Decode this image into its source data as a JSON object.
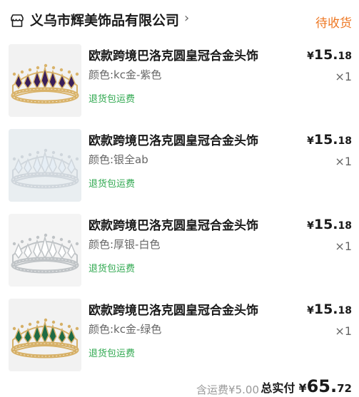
{
  "header": {
    "shop_icon": "store-icon",
    "shop_name": "义乌市辉美饰品有限公司",
    "chevron": "›",
    "status": "待收货"
  },
  "items": [
    {
      "title": "欧款跨境巴洛克圆皇冠合金头饰",
      "spec": "颜色:kc金-紫色",
      "tag": "退货包运费",
      "price_currency": "¥",
      "price_int": "15.",
      "price_dec": "18",
      "qty": "×1",
      "image": "crown-gold-purple",
      "colors": {
        "metal": "#d9b36a",
        "gem": "#3a1f5a",
        "bg": "#f2f2f2"
      }
    },
    {
      "title": "欧款跨境巴洛克圆皇冠合金头饰",
      "spec": "颜色:银全ab",
      "tag": "退货包运费",
      "price_currency": "¥",
      "price_int": "15.",
      "price_dec": "18",
      "qty": "×1",
      "image": "crown-silver-ab",
      "colors": {
        "metal": "#cfd6dc",
        "gem": "#e6eef5",
        "bg": "#e9eef1"
      }
    },
    {
      "title": "欧款跨境巴洛克圆皇冠合金头饰",
      "spec": "颜色:厚银-白色",
      "tag": "退货包运费",
      "price_currency": "¥",
      "price_int": "15.",
      "price_dec": "18",
      "qty": "×1",
      "image": "crown-silver-white",
      "colors": {
        "metal": "#bfc3c6",
        "gem": "#ffffff",
        "bg": "#f4f4f4"
      }
    },
    {
      "title": "欧款跨境巴洛克圆皇冠合金头饰",
      "spec": "颜色:kc金-绿色",
      "tag": "退货包运费",
      "price_currency": "¥",
      "price_int": "15.",
      "price_dec": "18",
      "qty": "×1",
      "image": "crown-gold-green",
      "colors": {
        "metal": "#d6b067",
        "gem": "#1e6b45",
        "bg": "#f2f2f2"
      }
    }
  ],
  "footer": {
    "shipping": "含运费¥5.00",
    "total_label": "总实付",
    "total_currency": "¥",
    "total_int": "65.",
    "total_dec": "72"
  },
  "colors": {
    "accent_status": "#ee7722",
    "tag_green": "#2fa84f"
  }
}
